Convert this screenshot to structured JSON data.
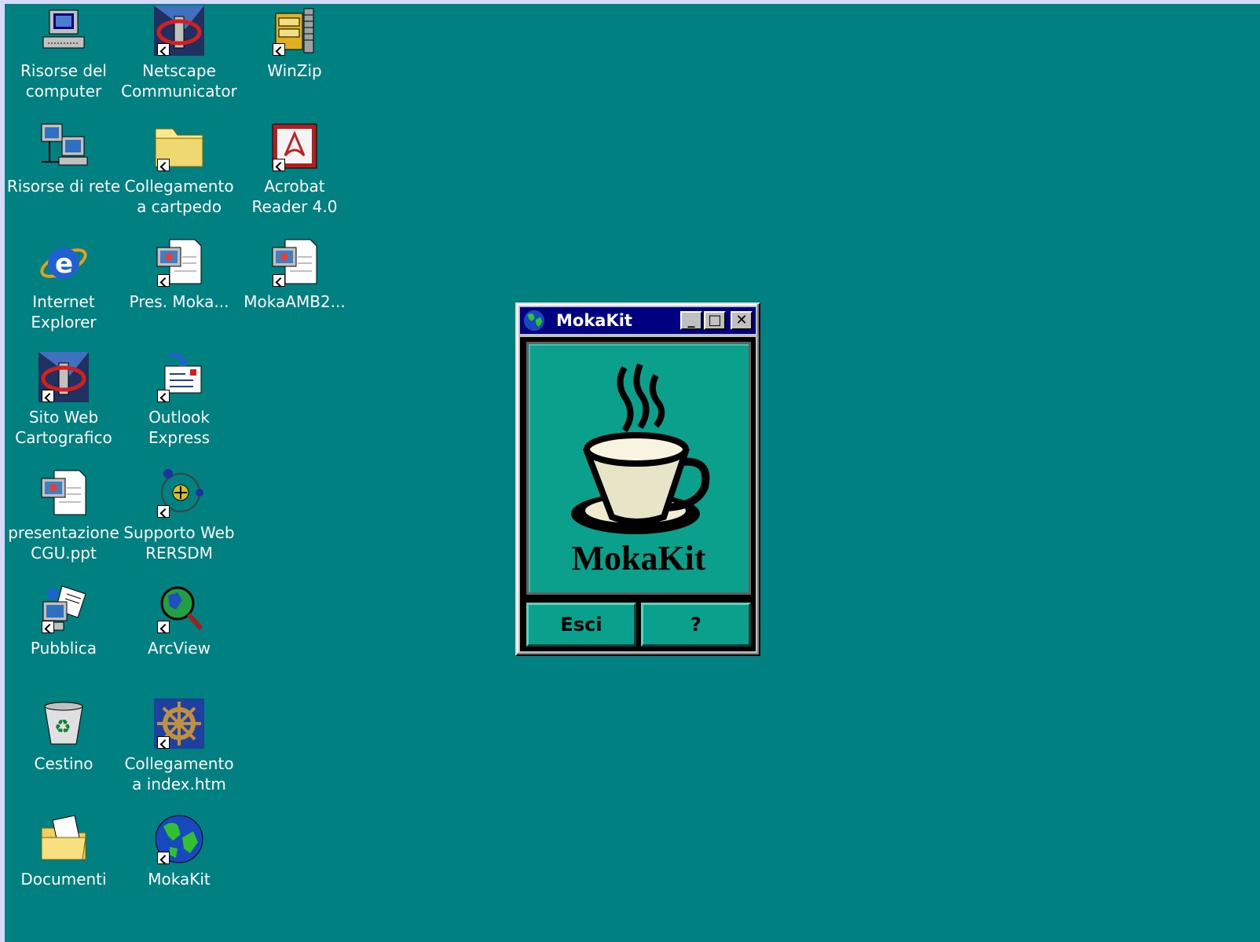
{
  "desktop": {
    "background_color": "#008080",
    "icons": [
      {
        "label": "Risorse del\ncomputer",
        "icon": "my-computer-icon"
      },
      {
        "label": "Netscape\nCommunicator",
        "icon": "netscape-icon"
      },
      {
        "label": "WinZip",
        "icon": "winzip-icon"
      },
      {
        "label": "Risorse di rete",
        "icon": "network-icon"
      },
      {
        "label": "Collegamento\na cartpedo",
        "icon": "folder-icon"
      },
      {
        "label": "Acrobat\nReader 4.0",
        "icon": "acrobat-icon"
      },
      {
        "label": "Internet\nExplorer",
        "icon": "internet-explorer-icon"
      },
      {
        "label": "Pres. Moka...",
        "icon": "powerpoint-doc-icon"
      },
      {
        "label": "MokaAMB2...",
        "icon": "powerpoint-doc-icon"
      },
      {
        "label": "Sito Web\nCartografico",
        "icon": "netscape-icon"
      },
      {
        "label": "Outlook\nExpress",
        "icon": "outlook-express-icon"
      },
      {
        "label": "presentazione\nCGU.ppt",
        "icon": "powerpoint-doc-icon"
      },
      {
        "label": "Supporto Web\nRERSDM",
        "icon": "web-support-icon"
      },
      {
        "label": "Pubblica",
        "icon": "publish-icon"
      },
      {
        "label": "ArcView",
        "icon": "arcview-icon"
      },
      {
        "label": "Cestino",
        "icon": "recycle-bin-icon"
      },
      {
        "label": "Collegamento\na index.htm",
        "icon": "helm-icon"
      },
      {
        "label": "Documenti",
        "icon": "documents-folder-icon"
      },
      {
        "label": "MokaKit",
        "icon": "globe-icon"
      }
    ]
  },
  "window": {
    "title": "MokaKit",
    "title_icon": "globe-icon",
    "controls": {
      "minimize": "_",
      "maximize": "□",
      "close": "✕"
    },
    "splash_title": "MokaKit",
    "splash_icon": "coffee-cup-icon",
    "buttons": {
      "exit": "Esci",
      "help": "?"
    },
    "accent_color": "#0aa08c",
    "titlebar_color": "#000080"
  }
}
